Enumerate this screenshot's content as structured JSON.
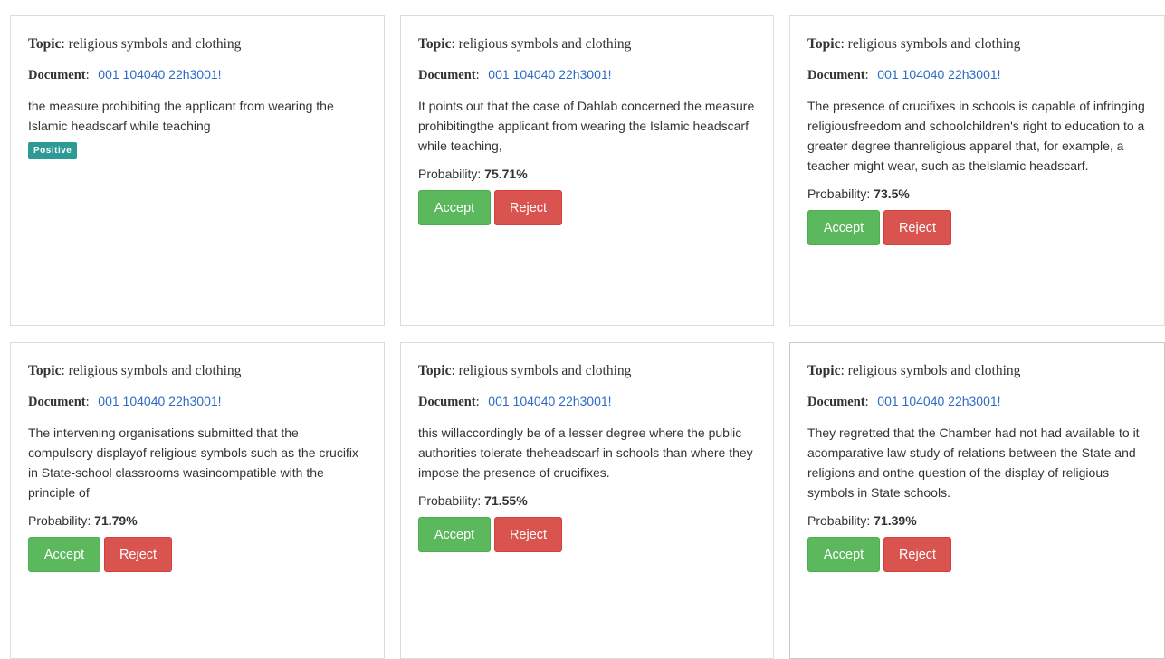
{
  "labels": {
    "topic": "Topic",
    "document": "Document",
    "probability": "Probability:",
    "accept": "Accept",
    "reject": "Reject"
  },
  "cards": [
    {
      "topic": "religious symbols and clothing",
      "document": "001 104040 22h3001!",
      "excerpt": "the measure prohibiting the applicant from wearing the Islamic headscarf while teaching",
      "badge": "Positive"
    },
    {
      "topic": "religious symbols and clothing",
      "document": "001 104040 22h3001!",
      "excerpt": "It points out that the case of Dahlab concerned the measure prohibitingthe applicant from wearing the Islamic headscarf while teaching,",
      "probability": "75.71%"
    },
    {
      "topic": "religious symbols and clothing",
      "document": "001 104040 22h3001!",
      "excerpt": "The presence of crucifixes in schools is capable of infringing religiousfreedom and schoolchildren's right to education to a greater degree thanreligious apparel that, for example, a teacher might wear, such as theIslamic headscarf.",
      "probability": "73.5%"
    },
    {
      "topic": "religious symbols and clothing",
      "document": "001 104040 22h3001!",
      "excerpt": "The intervening organisations submitted that the compulsory displayof religious symbols such as the crucifix in State-school classrooms wasincompatible with the principle of",
      "probability": "71.79%"
    },
    {
      "topic": "religious symbols and clothing",
      "document": "001 104040 22h3001!",
      "excerpt": "this willaccordingly be of a lesser degree where the public authorities tolerate theheadscarf in schools than where they impose the presence of crucifixes.",
      "probability": "71.55%"
    },
    {
      "topic": "religious symbols and clothing",
      "document": "001 104040 22h3001!",
      "excerpt": "They regretted that the Chamber had not had available to it acomparative law study of relations between the State and religions and onthe question of the display of religious symbols in State schools.",
      "probability": "71.39%"
    }
  ],
  "colors": {
    "accept": "#5cb85c",
    "reject": "#d9534f",
    "badge": "#2e9a96",
    "link": "#2d6bc4"
  }
}
